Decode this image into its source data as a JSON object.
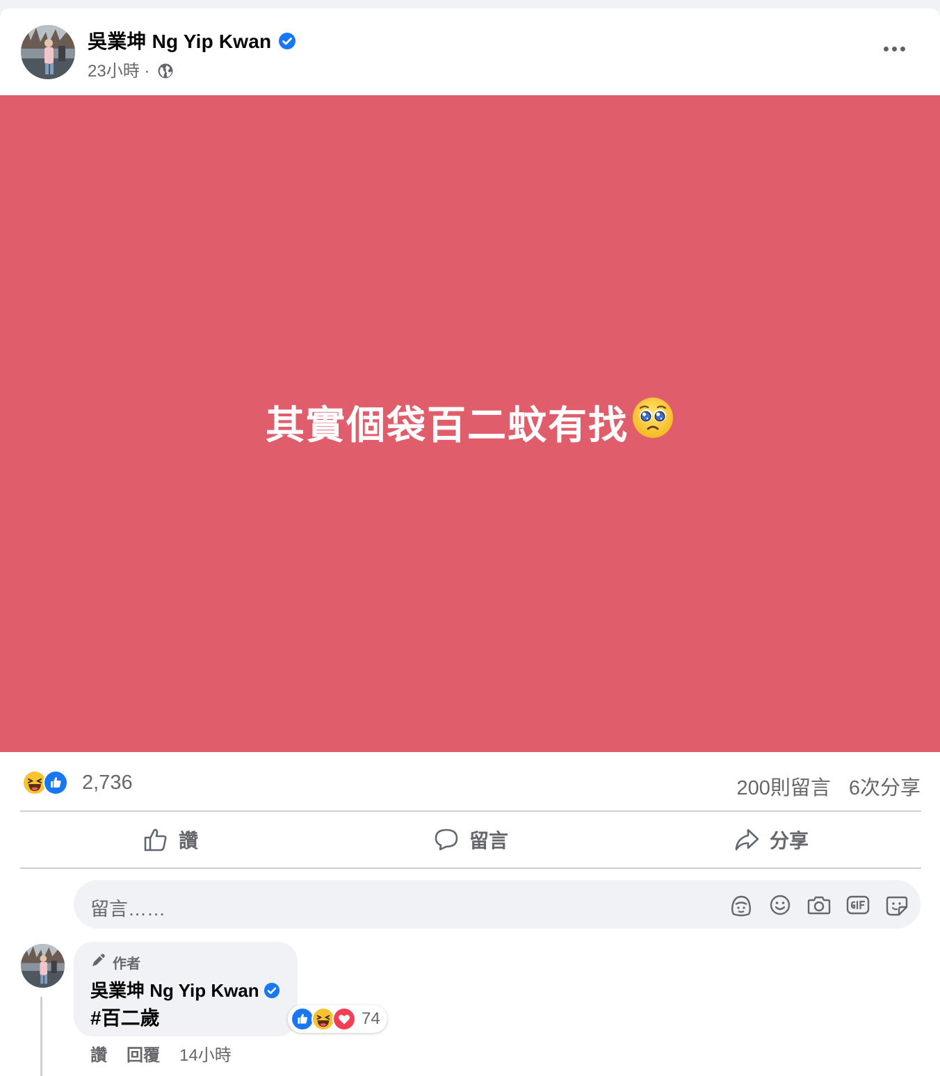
{
  "post": {
    "author": "吳業坤 Ng Yip Kwan",
    "time": "23小時",
    "separator": "·",
    "privacy_icon": "globe-icon",
    "background_color": "#e05e6b",
    "text": "其實個袋百二蚊有找",
    "text_emoji": "pleading-face-emoji"
  },
  "stats": {
    "reaction_icons": [
      "haha-icon",
      "like-icon"
    ],
    "reaction_count": "2,736",
    "comments": "200則留言",
    "shares": "6次分享"
  },
  "actions": {
    "like": "讚",
    "comment": "留言",
    "share": "分享"
  },
  "comment_input": {
    "placeholder": "留言……",
    "icons": [
      "avatar-sticker-icon",
      "emoji-icon",
      "camera-icon",
      "gif-icon",
      "sticker-icon"
    ]
  },
  "comment": {
    "badge": "作者",
    "author": "吳業坤 Ng Yip Kwan",
    "text": "#百二歲",
    "reaction_icons": [
      "like-icon",
      "haha-icon",
      "love-icon"
    ],
    "reaction_count": "74",
    "like_label": "讚",
    "reply_label": "回覆",
    "time": "14小時"
  },
  "colors": {
    "facebook_blue": "#1877f2",
    "secondary_text": "#65676b",
    "love_red": "#f33e58"
  }
}
